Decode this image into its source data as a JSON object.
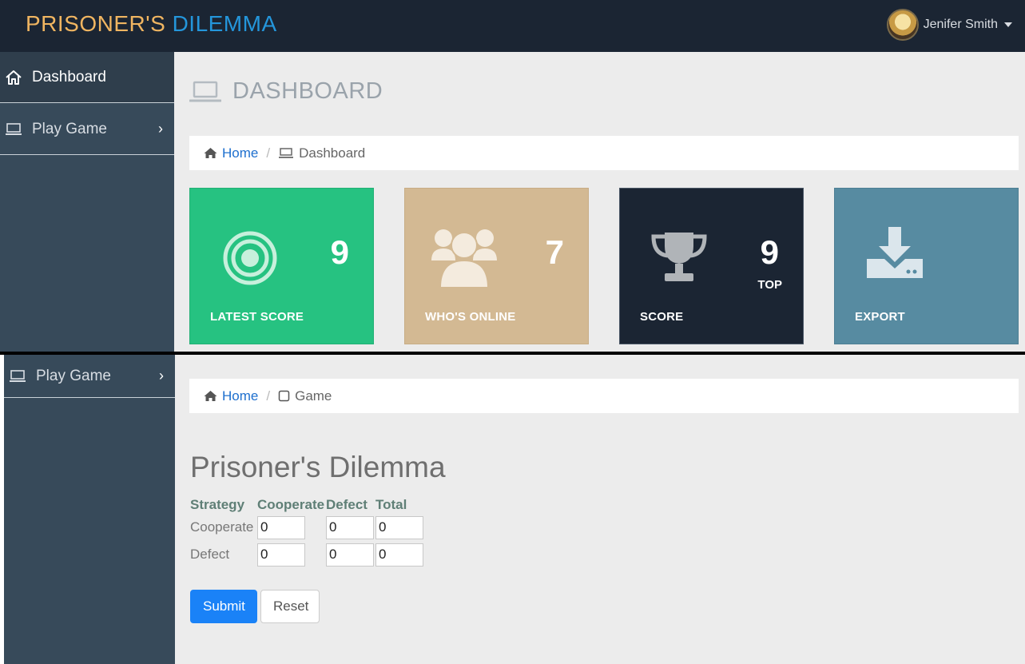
{
  "brand": {
    "part1": "PRISONER'S",
    "part2": "DILEMMA",
    "color1": "#f0b561",
    "color2": "#2496db"
  },
  "user": {
    "name": "Jenifer Smith"
  },
  "sidebar_top": {
    "items": [
      {
        "label": "Dashboard",
        "icon": "home-icon"
      },
      {
        "label": "Play Game",
        "icon": "laptop-icon"
      }
    ]
  },
  "sidebar_bottom": {
    "items": [
      {
        "label": "Play Game",
        "icon": "laptop-icon"
      }
    ]
  },
  "page": {
    "title": "DASHBOARD"
  },
  "breadcrumb_top": {
    "home": "Home",
    "current": "Dashboard"
  },
  "tiles": [
    {
      "value": "9",
      "label": "LATEST SCORE",
      "icon": "target-icon",
      "color": "#26c281"
    },
    {
      "value": "7",
      "label": "WHO'S ONLINE",
      "icon": "users-icon",
      "color": "#d3b993"
    },
    {
      "value": "9",
      "sub": "TOP",
      "label": "SCORE",
      "icon": "trophy-icon",
      "color": "#1b2533"
    },
    {
      "label": "EXPORT",
      "icon": "download-icon",
      "color": "#578ba1"
    }
  ],
  "breadcrumb_bottom": {
    "home": "Home",
    "current": "Game"
  },
  "game": {
    "title": "Prisoner's Dilemma",
    "headers": [
      "Strategy",
      "Cooperate",
      "Defect",
      "Total"
    ],
    "rows": [
      {
        "label": "Cooperate",
        "cooperate": "0",
        "defect": "0",
        "total": "0"
      },
      {
        "label": "Defect",
        "cooperate": "0",
        "defect": "0",
        "total": "0"
      }
    ],
    "submit": "Submit",
    "reset": "Reset"
  }
}
